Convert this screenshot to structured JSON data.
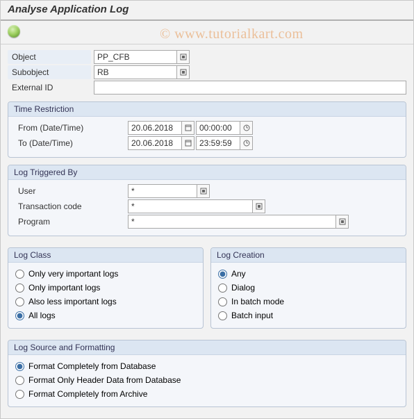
{
  "title": "Analyse Application Log",
  "watermark": "© www.tutorialkart.com",
  "top": {
    "object_label": "Object",
    "object_value": "PP_CFB",
    "subobject_label": "Subobject",
    "subobject_value": "RB",
    "extid_label": "External ID",
    "extid_value": ""
  },
  "time": {
    "title": "Time Restriction",
    "from_label": "From (Date/Time)",
    "from_date": "20.06.2018",
    "from_time": "00:00:00",
    "to_label": "To (Date/Time)",
    "to_date": "20.06.2018",
    "to_time": "23:59:59"
  },
  "triggered": {
    "title": "Log Triggered By",
    "user_label": "User",
    "user_value": "*",
    "tcode_label": "Transaction code",
    "tcode_value": "*",
    "program_label": "Program",
    "program_value": "*"
  },
  "logclass": {
    "title": "Log Class",
    "opts": [
      "Only very important logs",
      "Only important logs",
      "Also less important logs",
      "All logs"
    ],
    "selected": 3
  },
  "logcreation": {
    "title": "Log Creation",
    "opts": [
      "Any",
      "Dialog",
      "In batch mode",
      "Batch input"
    ],
    "selected": 0
  },
  "source": {
    "title": "Log Source and Formatting",
    "opts": [
      "Format Completely from Database",
      "Format Only Header Data from Database",
      "Format Completely from Archive"
    ],
    "selected": 0
  }
}
